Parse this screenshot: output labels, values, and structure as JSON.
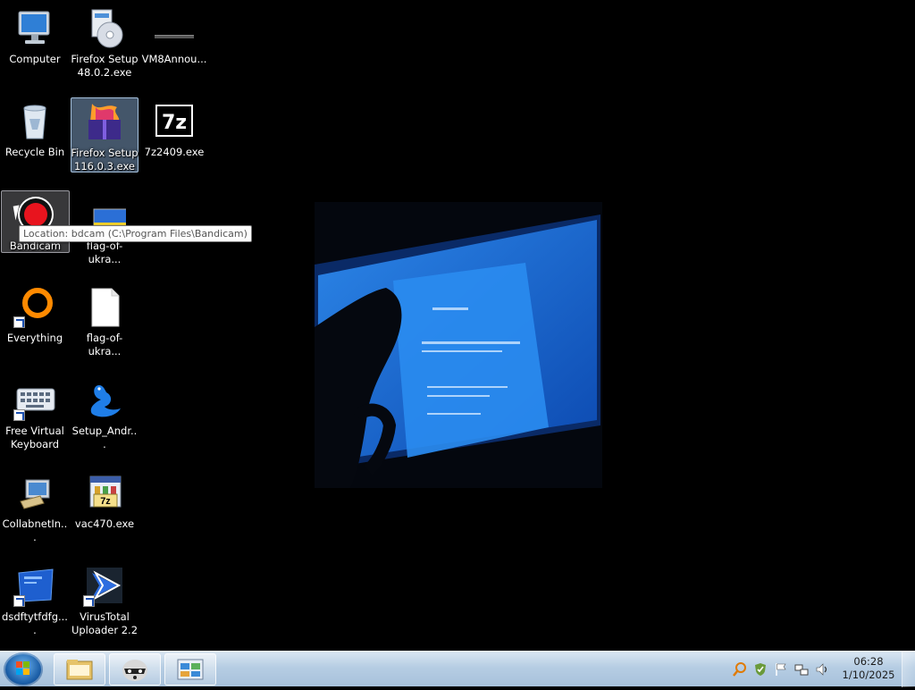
{
  "desktop": {
    "icons": [
      {
        "label": "Computer"
      },
      {
        "label": "Firefox Setup 48.0.2.exe"
      },
      {
        "label": "VM8Annou..."
      },
      {
        "label": "Recycle Bin"
      },
      {
        "label": "Firefox Setup 116.0.3.exe"
      },
      {
        "label": "7z2409.exe"
      },
      {
        "label": "Bandicam"
      },
      {
        "label": "flag-of-ukra..."
      },
      {
        "label": "Everything"
      },
      {
        "label": "flag-of-ukra..."
      },
      {
        "label": "Free Virtual Keyboard"
      },
      {
        "label": "Setup_Andr..."
      },
      {
        "label": "CollabnetIn..."
      },
      {
        "label": "vac470.exe"
      },
      {
        "label": "dsdftytfdfg...."
      },
      {
        "label": "VirusTotal Uploader 2.2"
      }
    ],
    "tooltip": "Location: bdcam (C:\\Program Files\\Bandicam)",
    "seven_zip_glyph": "7z",
    "vac_glyph": "7z"
  },
  "taskbar": {
    "clock": {
      "time": "06:28",
      "date": "1/10/2025"
    },
    "pinned": [
      "explorer",
      "raccoon-app",
      "control-panel"
    ],
    "tray_icons": [
      "search-icon",
      "security-shield-icon",
      "action-center-flag-icon",
      "network-icon",
      "volume-icon"
    ]
  },
  "colors": {
    "desktop_bg": "#000000",
    "selection": "#96beeb",
    "taskbar_top": "#d9e6f2"
  }
}
